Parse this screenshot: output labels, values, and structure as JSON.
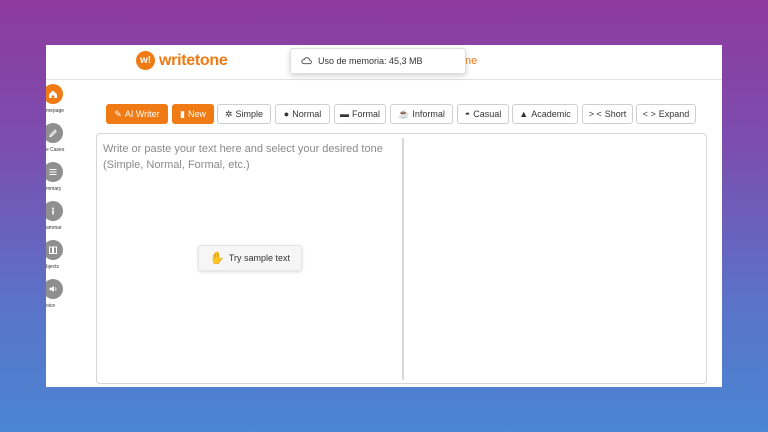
{
  "app": {
    "logo_mark": "w!",
    "logo_text": "writetone",
    "header_tail_text": "ne"
  },
  "memory_popup": {
    "icon": "cloud-icon",
    "text": "Uso de memoria: 45,3 MB"
  },
  "sidebar": {
    "items": [
      {
        "label": "mepage",
        "icon": "home-icon",
        "active": true
      },
      {
        "label": "e Cases",
        "icon": "pencil-icon",
        "active": false
      },
      {
        "label": "mmary",
        "icon": "list-icon",
        "active": false
      },
      {
        "label": "ammar",
        "icon": "info-icon",
        "active": false
      },
      {
        "label": "bjects",
        "icon": "book-icon",
        "active": false
      },
      {
        "label": "oice",
        "icon": "speaker-icon",
        "active": false
      }
    ],
    "bottom_icon": "tool-icon"
  },
  "toolbar": {
    "ai_writer": "AI Writer",
    "new": "New",
    "simple": "Simple",
    "normal": "Normal",
    "formal": "Formal",
    "informal": "Informal",
    "casual": "Casual",
    "academic": "Academic",
    "short": "Short",
    "expand": "Expand"
  },
  "editor": {
    "placeholder": "Write or paste your text here and select your desired tone (Simple, Normal, Formal, etc.)",
    "sample_button": "Try sample text"
  },
  "colors": {
    "accent": "#f07a14",
    "icon_gray": "#8f8f8f"
  }
}
